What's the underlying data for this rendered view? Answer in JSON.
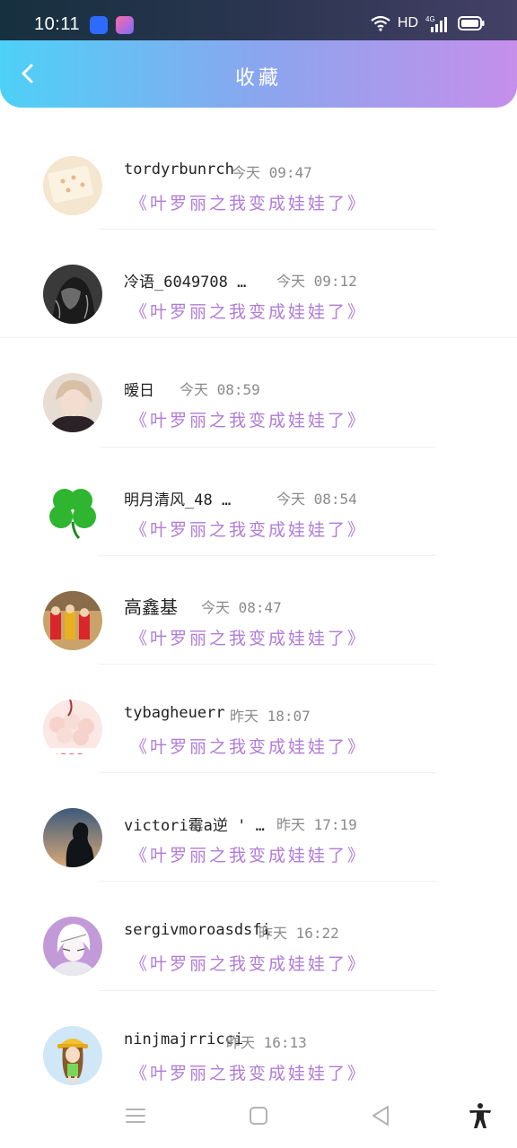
{
  "status_bar": {
    "time": "10:11",
    "network": "HD",
    "signal": "4G",
    "icons": [
      "baidu-app-icon",
      "paint-app-icon",
      "wifi-icon",
      "signal-icon",
      "battery-icon"
    ]
  },
  "header": {
    "title": "收藏",
    "back_icon": "chevron-left-icon",
    "gradient_start": "#4dd1f6",
    "gradient_end": "#c58fea"
  },
  "items": [
    {
      "name": "tordyrbunrch",
      "time": "今天 09:47",
      "content": "《叶罗丽之我变成娃娃了》"
    },
    {
      "name": "冷语_6049708 …",
      "time": "今天 09:12",
      "content": "《叶罗丽之我变成娃娃了》"
    },
    {
      "name": "暧日",
      "time": "今天 08:59",
      "content": "《叶罗丽之我变成娃娃了》"
    },
    {
      "name": "明月清风_48 …",
      "time": "今天 08:54",
      "content": "《叶罗丽之我变成娃娃了》"
    },
    {
      "name": "高鑫基",
      "time": "今天 08:47",
      "content": "《叶罗丽之我变成娃娃了》"
    },
    {
      "name": "tybagheuerr",
      "time": "昨天 18:07",
      "content": "《叶罗丽之我变成娃娃了》"
    },
    {
      "name": "victori霉a逆 ' …",
      "time": "昨天 17:19",
      "content": "《叶罗丽之我变成娃娃了》"
    },
    {
      "name": "sergivmoroasdsfi",
      "time": "昨天 16:22",
      "content": "《叶罗丽之我变成娃娃了》"
    },
    {
      "name": "ninjmajrricci",
      "time": "昨天 16:13",
      "content": "《叶罗丽之我变成娃娃了》"
    }
  ],
  "nav_bar": {
    "icons": [
      "menu-icon",
      "home-icon",
      "back-icon",
      "accessibility-icon"
    ]
  },
  "colors": {
    "content_text": "#b07cd8",
    "name_text": "#222222",
    "time_text": "#8a8a8a"
  }
}
